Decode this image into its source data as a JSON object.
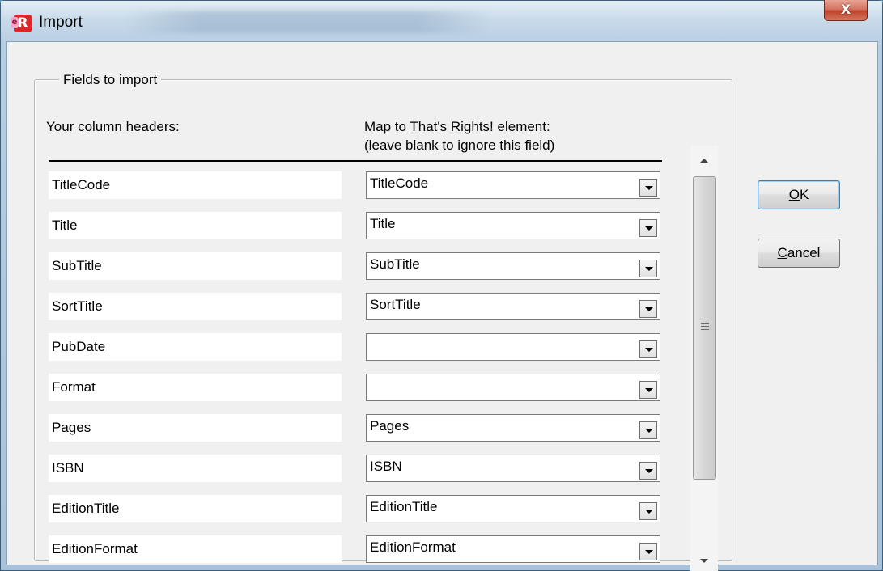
{
  "window": {
    "title": "Import",
    "app_icon": "R",
    "close_glyph": "X"
  },
  "group": {
    "legend": "Fields to import"
  },
  "headers": {
    "source": "Your column headers:",
    "target_line1": "Map to That's Rights! element:",
    "target_line2": "(leave blank to ignore this field)"
  },
  "rows": [
    {
      "label": "TitleCode",
      "value": "TitleCode"
    },
    {
      "label": "Title",
      "value": "Title"
    },
    {
      "label": "SubTitle",
      "value": "SubTitle"
    },
    {
      "label": "SortTitle",
      "value": "SortTitle"
    },
    {
      "label": "PubDate",
      "value": ""
    },
    {
      "label": "Format",
      "value": ""
    },
    {
      "label": "Pages",
      "value": "Pages"
    },
    {
      "label": "ISBN",
      "value": "ISBN"
    },
    {
      "label": "EditionTitle",
      "value": "EditionTitle"
    },
    {
      "label": "EditionFormat",
      "value": "EditionFormat"
    }
  ],
  "buttons": {
    "ok_mnemonic": "O",
    "ok_rest": "K",
    "cancel_mnemonic": "C",
    "cancel_rest": "ancel"
  },
  "icons": [
    "close-icon",
    "app-icon",
    "dropdown-arrow-icon",
    "scroll-up-icon",
    "scroll-down-icon",
    "scroll-grip-icon"
  ]
}
